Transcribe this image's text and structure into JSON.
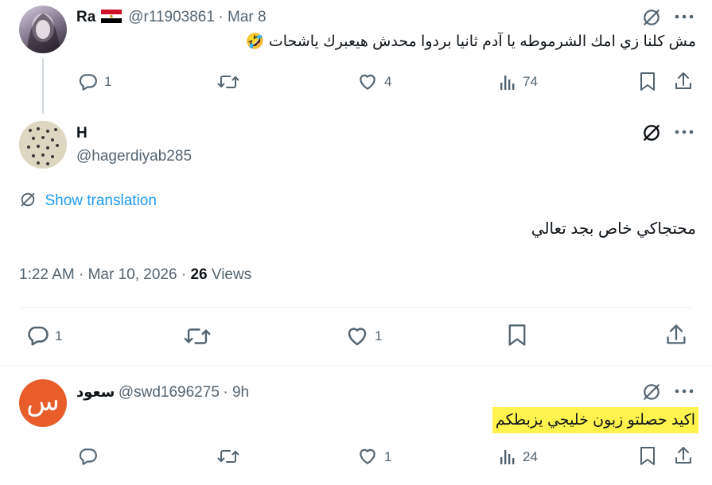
{
  "reply1": {
    "name": "Ra",
    "handle": "@r11903861",
    "date": "· Mar 8",
    "text": "مش كلنا زي امك الشرموطه يا آدم ثانيا بردوا محدش هيعبرك ياشحات 🤣",
    "replies": "1",
    "likes": "4",
    "views": "74"
  },
  "main": {
    "name": "H",
    "handle": "@hagerdiyab285",
    "show_translation": "Show translation",
    "text": "محتجاكي خاص بجد تعالي",
    "timestamp": "1:22 AM · Mar 10, 2026 ·",
    "views_count": "26",
    "views_label": "Views",
    "replies": "1",
    "likes": "1"
  },
  "reply2": {
    "avatar_letter": "س",
    "name": "سعود",
    "handle": "@swd1696275",
    "date": "· 9h",
    "text": "اكيد حصلتو زبون خليجي يزبطكم",
    "likes": "1",
    "views": "24"
  },
  "colors": {
    "text": "#0f1419",
    "secondary": "#536471",
    "link": "#1d9bf0",
    "highlight": "#fff34d",
    "avatar_orange": "#e85d2a"
  }
}
